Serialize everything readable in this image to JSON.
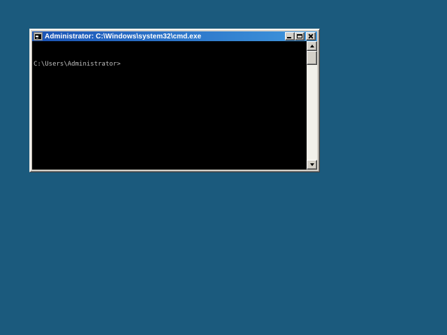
{
  "desktop": {
    "background_color": "#1b5a7d"
  },
  "window": {
    "title": "Administrator: C:\\Windows\\system32\\cmd.exe",
    "titlebar": {
      "gradient_left": "#1a53b5",
      "gradient_right": "#3f97dd",
      "text_color": "#ffffff"
    },
    "controls": [
      {
        "name": "minimize"
      },
      {
        "name": "maximize"
      },
      {
        "name": "close"
      }
    ]
  },
  "console": {
    "background_color": "#000000",
    "text_color": "#c0c0c0",
    "lines": [
      "C:\\Users\\Administrator>"
    ]
  },
  "scrollbar": {
    "orientation": "vertical",
    "thumb_position": "top"
  }
}
